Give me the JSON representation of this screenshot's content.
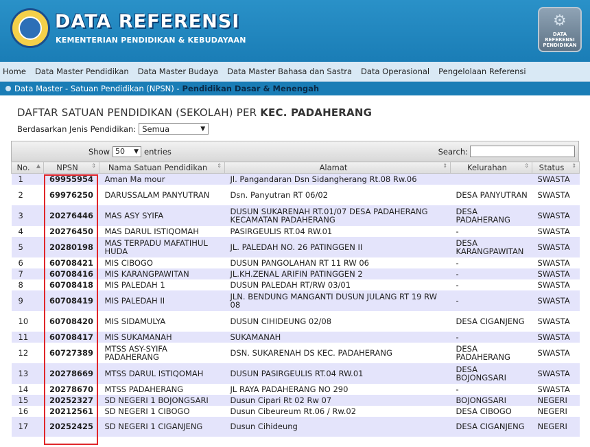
{
  "header": {
    "title": "DATA REFERENSI",
    "subtitle": "KEMENTERIAN PENDIDIKAN & KEBUDAYAAN",
    "badge_lines": [
      "DATA",
      "REFERENSI",
      "PENDIDIKAN"
    ]
  },
  "nav": [
    "Home",
    "Data Master Pendidikan",
    "Data Master Budaya",
    "Data Master Bahasa dan Sastra",
    "Data Operasional",
    "Pengelolaan Referensi"
  ],
  "breadcrumb": {
    "path": "Data Master - Satuan Pendidikan (NPSN) -",
    "current": "Pendidikan Dasar & Menengah"
  },
  "page": {
    "title_prefix": "DAFTAR SATUAN PENDIDIKAN (SEKOLAH) PER",
    "title_bold": "KEC. PADAHERANG",
    "filter_label": "Berdasarkan Jenis Pendidikan:",
    "filter_value": "Semua"
  },
  "toolbar": {
    "show_label": "Show",
    "show_value": "50",
    "entries_label": "entries",
    "search_label": "Search:"
  },
  "columns": [
    "No.",
    "NPSN",
    "Nama Satuan Pendidikan",
    "Alamat",
    "Kelurahan",
    "Status"
  ],
  "rows": [
    {
      "no": "1",
      "npsn": "69955954",
      "nama": "Aman Ma mour",
      "alamat": "Jl. Pangandaran Dsn Sidangherang Rt.08 Rw.06",
      "kel": "",
      "status": "SWASTA"
    },
    {
      "no": "2",
      "npsn": "69976250",
      "nama": "DARUSSALAM PANYUTRAN",
      "alamat": "Dsn. Panyutran RT 06/02",
      "kel": "DESA PANYUTRAN",
      "status": "SWASTA"
    },
    {
      "no": "3",
      "npsn": "20276446",
      "nama": "MAS ASY SYIFA",
      "alamat": "DUSUN SUKARENAH RT.01/07 DESA PADAHERANG KECAMATAN PADAHERANG",
      "kel": "DESA PADAHERANG",
      "status": "SWASTA"
    },
    {
      "no": "4",
      "npsn": "20276450",
      "nama": "MAS DARUL ISTIQOMAH",
      "alamat": "PASIRGEULIS RT.04 RW.01",
      "kel": "-",
      "status": "SWASTA"
    },
    {
      "no": "5",
      "npsn": "20280198",
      "nama": "MAS TERPADU MAFATIHUL HUDA",
      "alamat": "JL. PALEDAH NO. 26 PATINGGEN II",
      "kel": "DESA KARANGPAWITAN",
      "status": "SWASTA"
    },
    {
      "no": "6",
      "npsn": "60708421",
      "nama": "MIS CIBOGO",
      "alamat": "DUSUN PANGOLAHAN RT 11 RW 06",
      "kel": "-",
      "status": "SWASTA"
    },
    {
      "no": "7",
      "npsn": "60708416",
      "nama": "MIS KARANGPAWITAN",
      "alamat": "JL.KH.ZENAL ARIFIN PATINGGEN 2",
      "kel": "-",
      "status": "SWASTA"
    },
    {
      "no": "8",
      "npsn": "60708418",
      "nama": "MIS PALEDAH 1",
      "alamat": "DUSUN PALEDAH RT/RW 03/01",
      "kel": "-",
      "status": "SWASTA"
    },
    {
      "no": "9",
      "npsn": "60708419",
      "nama": "MIS PALEDAH II",
      "alamat": "JLN. BENDUNG MANGANTI DUSUN JULANG RT 19 RW 08",
      "kel": "-",
      "status": "SWASTA"
    },
    {
      "no": "10",
      "npsn": "60708420",
      "nama": "MIS SIDAMULYA",
      "alamat": "DUSUN CIHIDEUNG 02/08",
      "kel": "DESA CIGANJENG",
      "status": "SWASTA"
    },
    {
      "no": "11",
      "npsn": "60708417",
      "nama": "MIS SUKAMANAH",
      "alamat": "SUKAMANAH",
      "kel": "-",
      "status": "SWASTA"
    },
    {
      "no": "12",
      "npsn": "60727389",
      "nama": "MTSS ASY-SYIFA PADAHERANG",
      "alamat": "DSN. SUKARENAH DS KEC. PADAHERANG",
      "kel": "DESA PADAHERANG",
      "status": "SWASTA"
    },
    {
      "no": "13",
      "npsn": "20278669",
      "nama": "MTSS DARUL ISTIQOMAH",
      "alamat": "DUSUN PASIRGEULIS RT.04 RW.01",
      "kel": "DESA BOJONGSARI",
      "status": "SWASTA"
    },
    {
      "no": "14",
      "npsn": "20278670",
      "nama": "MTSS PADAHERANG",
      "alamat": "JL RAYA PADAHERANG NO 290",
      "kel": "-",
      "status": "SWASTA"
    },
    {
      "no": "15",
      "npsn": "20252327",
      "nama": "SD NEGERI 1 BOJONGSARI",
      "alamat": "Dusun Cipari Rt 02 Rw 07",
      "kel": "BOJONGSARI",
      "status": "NEGERI"
    },
    {
      "no": "16",
      "npsn": "20212561",
      "nama": "SD NEGERI 1 CIBOGO",
      "alamat": "Dusun Cibeureum Rt.06 / Rw.02",
      "kel": "DESA CIBOGO",
      "status": "NEGERI"
    },
    {
      "no": "17",
      "npsn": "20252425",
      "nama": "SD NEGERI 1 CIGANJENG",
      "alamat": "Dusun Cihideung",
      "kel": "DESA CIGANJENG",
      "status": "NEGERI"
    }
  ]
}
